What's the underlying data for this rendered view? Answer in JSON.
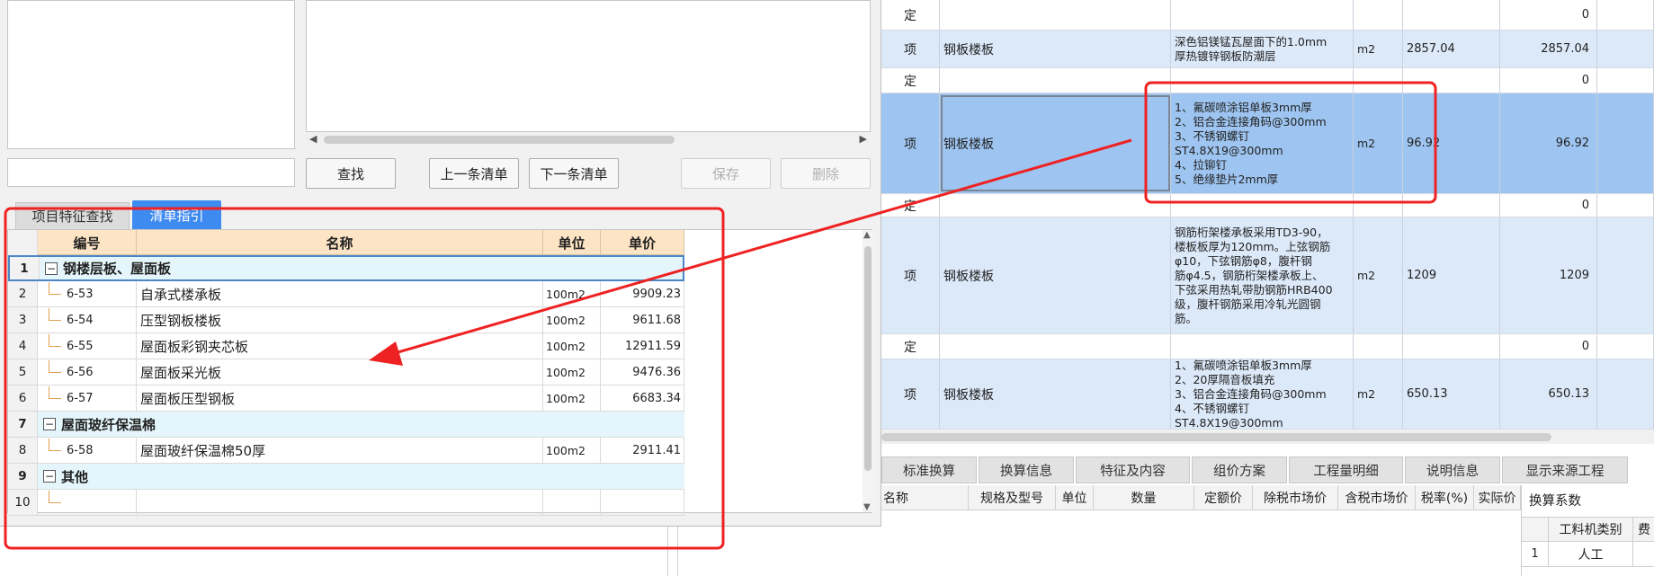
{
  "right_grid": {
    "rows": [
      {
        "type": "定",
        "name": "",
        "desc": "",
        "unit": "",
        "qty": "",
        "amount": "0",
        "h": 34
      },
      {
        "type": "项",
        "name": "钢板楼板",
        "desc": "深色铝镁锰瓦屋面下的1.0mm\n厚热镀锌钢板防潮层",
        "unit": "m2",
        "qty": "2857.04",
        "amount": "2857.04",
        "h": 42
      },
      {
        "type": "定",
        "name": "",
        "desc": "",
        "unit": "",
        "qty": "",
        "amount": "0",
        "h": 28
      },
      {
        "type": "项",
        "name": "钢板楼板",
        "desc": "1、氟碳喷涂铝单板3mm厚\n2、铝合金连接角码@300mm\n3、不锈钢螺钉\nST4.8X19@300mm\n4、拉铆钉\n5、绝缘垫片2mm厚",
        "unit": "m2",
        "qty": "96.92",
        "amount": "96.92",
        "h": 112,
        "selected": true
      },
      {
        "type": "定",
        "name": "",
        "desc": "",
        "unit": "",
        "qty": "",
        "amount": "0",
        "h": 26
      },
      {
        "type": "项",
        "name": "钢板楼板",
        "desc": "钢筋桁架楼承板采用TD3-90，\n楼板板厚为120mm。上弦钢筋\nφ10，下弦钢筋φ8，腹杆钢\n筋φ4.5，钢筋桁架楼承板上、\n下弦采用热轧带肋钢筋HRB400\n级，腹杆钢筋采用冷轧光圆钢\n筋。",
        "unit": "m2",
        "qty": "1209",
        "amount": "1209",
        "h": 130
      },
      {
        "type": "定",
        "name": "",
        "desc": "",
        "unit": "",
        "qty": "",
        "amount": "0",
        "h": 28
      },
      {
        "type": "项",
        "name": "钢板楼板",
        "desc": "1、氟碳喷涂铝单板3mm厚\n2、20厚隔音板填充\n3、铝合金连接角码@300mm\n4、不锈钢螺钉\nST4.8X19@300mm",
        "unit": "m2",
        "qty": "650.13",
        "amount": "650.13",
        "h": 78
      }
    ]
  },
  "bottom_tabs": [
    "标准换算",
    "换算信息",
    "特征及内容",
    "组价方案",
    "工程量明细",
    "说明信息",
    "显示来源工程"
  ],
  "bottom_headers": [
    "名称",
    "规格及型号",
    "单位",
    "数量",
    "定额价",
    "除税市场价",
    "含税市场价",
    "税率(%)",
    "实际价"
  ],
  "coef_panel": {
    "title": "换算系数",
    "headers": [
      "",
      "工料机类别",
      "费"
    ],
    "rows": [
      {
        "no": "1",
        "type": "人工"
      }
    ]
  },
  "dialog": {
    "buttons": {
      "find": "查找",
      "prev": "上一条清单",
      "next": "下一条清单",
      "save": "保存",
      "delete": "删除"
    },
    "tabs": {
      "feature": "项目特征查找",
      "guide": "清单指引"
    },
    "list": {
      "headers": {
        "code": "编号",
        "name": "名称",
        "unit": "单位",
        "price": "单价"
      },
      "rows": [
        {
          "no": "1",
          "group": true,
          "name": "钢楼层板、屋面板"
        },
        {
          "no": "2",
          "code": "6-53",
          "name": "自承式楼承板",
          "unit": "100m2",
          "price": "9909.23"
        },
        {
          "no": "3",
          "code": "6-54",
          "name": "压型钢板楼板",
          "unit": "100m2",
          "price": "9611.68"
        },
        {
          "no": "4",
          "code": "6-55",
          "name": "屋面板彩钢夹芯板",
          "unit": "100m2",
          "price": "12911.59"
        },
        {
          "no": "5",
          "code": "6-56",
          "name": "屋面板采光板",
          "unit": "100m2",
          "price": "9476.36"
        },
        {
          "no": "6",
          "code": "6-57",
          "name": "屋面板压型钢板",
          "unit": "100m2",
          "price": "6683.34"
        },
        {
          "no": "7",
          "group": true,
          "name": "屋面玻纤保温棉"
        },
        {
          "no": "8",
          "code": "6-58",
          "name": "屋面玻纤保温棉50厚",
          "unit": "100m2",
          "price": "2911.41"
        },
        {
          "no": "9",
          "group": true,
          "name": "其他"
        },
        {
          "no": "10",
          "code": "",
          "name": "",
          "unit": "",
          "price": ""
        }
      ]
    }
  },
  "colors": {
    "accent": "#3d8af0",
    "annotation": "#ee2222",
    "header_bg": "#fce4c4",
    "selected_row": "#9ec5f1"
  }
}
